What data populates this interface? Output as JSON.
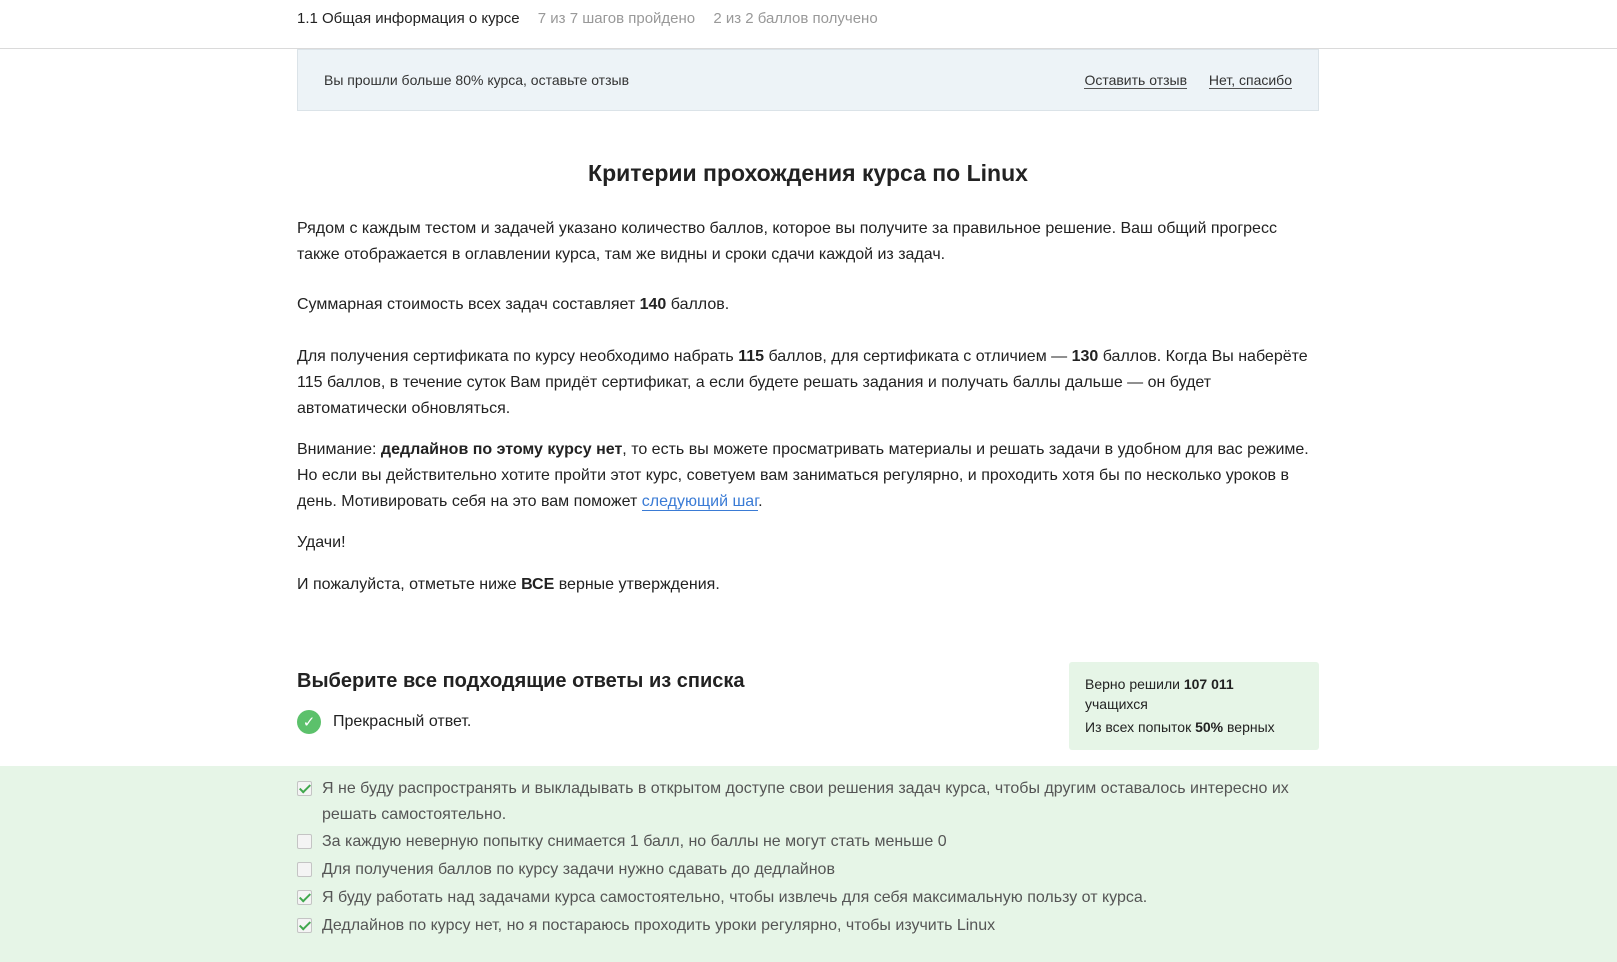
{
  "header": {
    "lesson_title": "1.1 Общая информация о курсе",
    "steps_progress": "7 из 7 шагов пройдено",
    "points_progress": "2 из 2 баллов  получено"
  },
  "feedback_banner": {
    "message": "Вы прошли больше 80% курса, оставьте отзыв",
    "leave_review": "Оставить отзыв",
    "decline": "Нет, спасибо"
  },
  "article": {
    "title": "Критерии прохождения курса по Linux",
    "p1": "Рядом с каждым тестом и задачей указано количество баллов, которое вы получите за правильное решение. Ваш общий прогресс также отображается в оглавлении курса, там же видны и сроки сдачи каждой из задач.",
    "p2_before": "Суммарная стоимость всех задач составляет ",
    "p2_bold": "140",
    "p2_after": " баллов.",
    "p3_a": "Для получения сертификата по курсу необходимо набрать ",
    "p3_b": "115",
    "p3_c": " баллов, для сертификата с отличием — ",
    "p3_d": "130",
    "p3_e": " баллов. Когда Вы наберёте 115 баллов, в течение суток Вам придёт сертификат, а если будете решать задания и получать баллы дальше — он будет автоматически обновляться.",
    "p4_a": "Внимание: ",
    "p4_b": "дедлайнов по этому курсу нет",
    "p4_c": ", то есть вы можете просматривать материалы и решать задачи в удобном для вас режиме. Но если вы действительно хотите пройти этот курс, советуем вам заниматься регулярно, и проходить хотя бы по несколько уроков в день. Мотивировать себя на это вам поможет ",
    "p4_link": "следующий шаг",
    "p4_d": ".",
    "p5": "Удачи!",
    "p6_a": "И пожалуйста, отметьте ниже ",
    "p6_b": "ВСЕ",
    "p6_c": " верные утверждения."
  },
  "quiz": {
    "title": "Выберите все подходящие ответы из списка",
    "result_text": "Прекрасный ответ.",
    "stats": {
      "solved_prefix": "Верно решили ",
      "solved_count": "107 011",
      "solved_suffix": " учащихся",
      "attempts_prefix": "Из всех попыток ",
      "attempts_percent": "50%",
      "attempts_suffix": " верных"
    },
    "options": [
      {
        "label": "Я не буду распространять и выкладывать в открытом доступе свои решения задач курса, чтобы другим оставалось интересно их решать самостоятельно.",
        "checked": true
      },
      {
        "label": "За каждую неверную попытку снимается 1 балл, но баллы не могут стать меньше 0",
        "checked": false
      },
      {
        "label": "Для получения баллов по курсу задачи нужно сдавать до дедлайнов",
        "checked": false
      },
      {
        "label": "Я буду работать над задачами курса самостоятельно, чтобы извлечь для себя максимальную пользу от курса.",
        "checked": true
      },
      {
        "label": "Дедлайнов по курсу нет, но я постараюсь проходить уроки регулярно, чтобы изучить Linux",
        "checked": true
      }
    ]
  },
  "colors": {
    "accent_green": "#5cc16b",
    "answers_bg": "#e6f5e7",
    "banner_bg": "#edf3f7",
    "link_blue": "#3a7bd5"
  }
}
